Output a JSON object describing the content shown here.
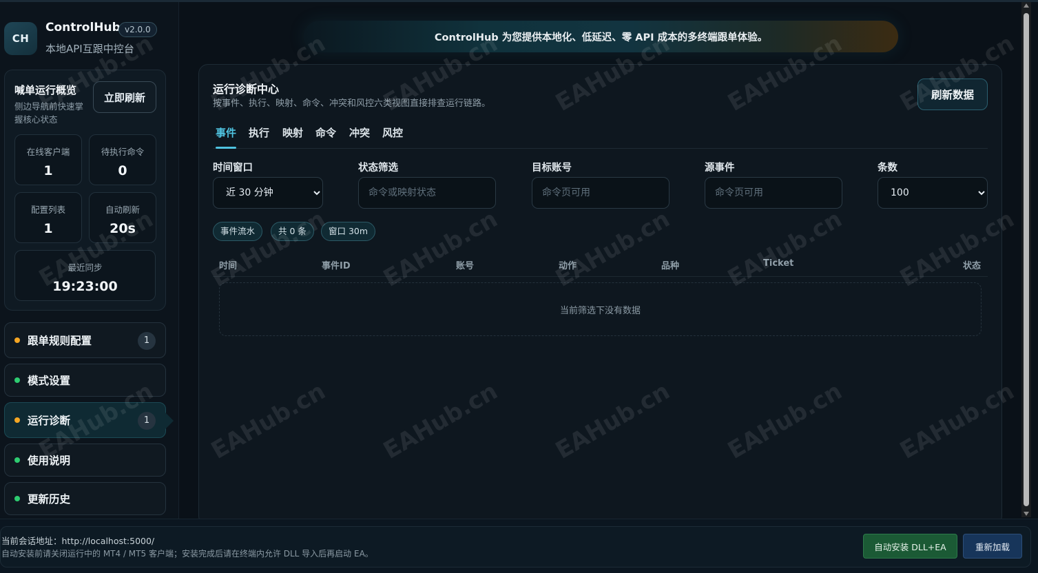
{
  "brand": {
    "logo": "CH",
    "name": "ControlHub",
    "version": "v2.0.0",
    "subtitle": "本地API互跟中控台"
  },
  "overview": {
    "title": "喊单运行概览",
    "desc": "侧边导航前快速掌握核心状态",
    "refresh_label": "立即刷新",
    "stats": [
      {
        "label": "在线客户端",
        "value": "1"
      },
      {
        "label": "待执行命令",
        "value": "0"
      },
      {
        "label": "配置列表",
        "value": "1"
      },
      {
        "label": "自动刷新",
        "value": "20s"
      },
      {
        "label": "最近同步",
        "value": "19:23:00"
      }
    ]
  },
  "nav": [
    {
      "label": "跟单规则配置",
      "status": "orange",
      "badge": "1"
    },
    {
      "label": "模式设置",
      "status": "green",
      "badge": ""
    },
    {
      "label": "运行诊断",
      "status": "orange",
      "badge": "1"
    },
    {
      "label": "使用说明",
      "status": "green",
      "badge": ""
    },
    {
      "label": "更新历史",
      "status": "green",
      "badge": ""
    }
  ],
  "banner": "ControlHub 为您提供本地化、低延迟、零 API 成本的多终端跟单体验。",
  "panel": {
    "title": "运行诊断中心",
    "desc": "按事件、执行、映射、命令、冲突和风控六类视图直接排查运行链路。",
    "refresh_label": "刷新数据",
    "tabs": [
      "事件",
      "执行",
      "映射",
      "命令",
      "冲突",
      "风控"
    ],
    "filters": {
      "time_window": {
        "label": "时间窗口",
        "value": "近 30 分钟"
      },
      "status": {
        "label": "状态筛选",
        "placeholder": "命令或映射状态"
      },
      "target_account": {
        "label": "目标账号",
        "placeholder": "命令页可用"
      },
      "source_event": {
        "label": "源事件",
        "placeholder": "命令页可用"
      },
      "count": {
        "label": "条数",
        "value": "100"
      }
    },
    "chips": [
      "事件流水",
      "共 0 条",
      "窗口 30m"
    ],
    "columns": [
      "时间",
      "事件ID",
      "账号",
      "动作",
      "品种",
      "Ticket",
      "状态"
    ],
    "empty_text": "当前筛选下没有数据"
  },
  "watermark": "EAHub.cn",
  "footer": {
    "session": "当前会话地址：http://localhost:5000/",
    "note": "自动安装前请关闭运行中的 MT4 / MT5 客户端；安装完成后请在终端内允许 DLL 导入后再启动 EA。",
    "install_label": "自动安装 DLL+EA",
    "reload_label": "重新加载"
  },
  "colors": {
    "accent": "#4fc3e0",
    "status_orange": "#f5a623",
    "status_green": "#2ecc71",
    "install_green": "#1b5a35",
    "reload_blue": "#17355a"
  }
}
